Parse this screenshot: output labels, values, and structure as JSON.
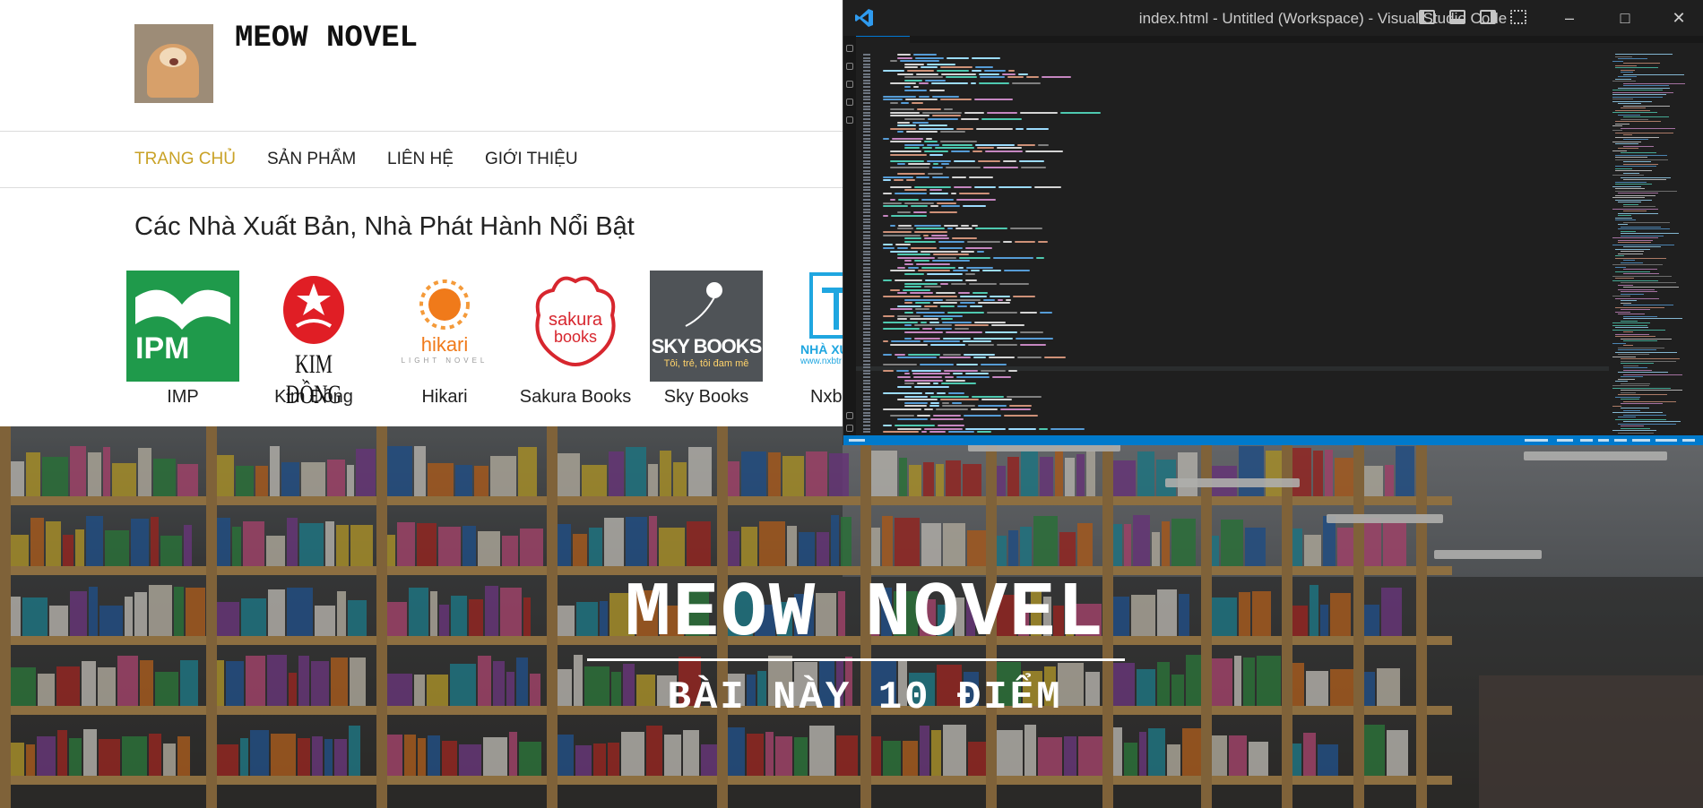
{
  "site": {
    "title": "MEOW NOVEL",
    "nav": [
      {
        "label": "TRANG CHỦ",
        "active": true
      },
      {
        "label": "SẢN PHẨM",
        "active": false
      },
      {
        "label": "LIÊN HỆ",
        "active": false
      },
      {
        "label": "GIỚI THIỆU",
        "active": false
      }
    ],
    "publishers_heading": "Các Nhà Xuất Bản, Nhà Phát Hành Nổi Bật",
    "publishers": [
      {
        "name": "IMP",
        "logo_text": "IPM"
      },
      {
        "name": "Kim Đồng",
        "logo_text": "KIM ĐỒNG"
      },
      {
        "name": "Hikari",
        "logo_text": "hikari",
        "logo_subtext": "LIGHT NOVEL"
      },
      {
        "name": "Sakura Books",
        "logo_text": "sakura",
        "logo_subtext": "books"
      },
      {
        "name": "Sky Books",
        "logo_text": "SKY BOOKS",
        "logo_subtext": "Tôi, trẻ, tôi đam mê"
      },
      {
        "name": "Nxb Tr",
        "logo_text": "NHÀ XUẤT",
        "logo_subtext": "www.nxbtr"
      }
    ],
    "accent_color": "#c9a227"
  },
  "hero": {
    "title": "MEOW NOVEL",
    "subtitle": "BÀI NÀY 10 ĐIỂM"
  },
  "vscode": {
    "window_title": "index.html - Untitled (Workspace) - Visual Studio Code",
    "minimize_icon": "minimize-icon",
    "maximize_icon": "maximize-icon",
    "close_icon": "close-icon",
    "status_color": "#007acc"
  }
}
